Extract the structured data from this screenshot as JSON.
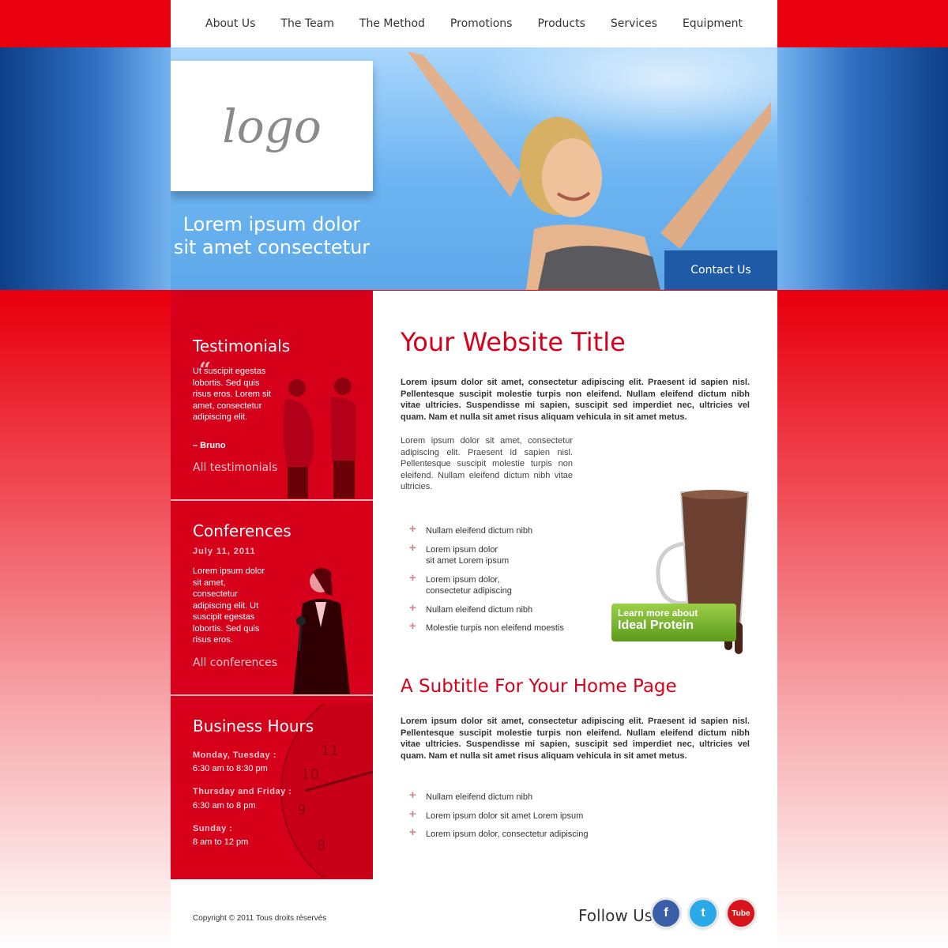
{
  "nav": {
    "items": [
      "About Us",
      "The Team",
      "The Method",
      "Promotions",
      "Products",
      "Services",
      "Equipment"
    ]
  },
  "hero": {
    "logo": "logo",
    "tagline_line1": "Lorem ipsum dolor",
    "tagline_line2": "sit amet consectetur",
    "contact_button": "Contact Us"
  },
  "sidebar": {
    "testimonials": {
      "title": "Testimonials",
      "quote": "Ut suscipit egestas lobortis. Sed quis risus eros. Lorem sit amet, consectetur adipiscing elit.",
      "author": "– Bruno",
      "link": "All testimonials"
    },
    "conferences": {
      "title": "Conferences",
      "date": "July 11, 2011",
      "text": "Lorem ipsum dolor sit amet, consectetur adipiscing elit. Ut suscipit egestas lobortis. Sed quis risus eros.",
      "link": "All conferences"
    },
    "hours": {
      "title": "Business Hours",
      "rows": [
        {
          "label": "Monday, Tuesday :",
          "value": "6:30 am to 8:30 pm"
        },
        {
          "label": "Thursday and Friday :",
          "value": "6:30 am to 8 pm"
        },
        {
          "label": "Sunday :",
          "value": "8 am to 12 pm"
        }
      ]
    }
  },
  "main": {
    "title": "Your Website Title",
    "intro": "Lorem ipsum dolor sit amet, consectetur adipiscing elit. Praesent id sapien nisl. Pellentesque suscipit molestie turpis non eleifend. Nullam eleifend dictum nibh vitae ultricies. Suspendisse mi sapien, suscipit sed imperdiet nec, ultricies vel quam. Nam et nulla sit amet risus aliquam vehicula in sit amet metus.",
    "para": "Lorem ipsum dolor sit amet, consectetur adipiscing elit. Praesent id sapien nisl. Pellentesque suscipit molestie turpis non eleifend. Nullam eleifend dictum nibh vitae ultricies.",
    "bullets1": [
      "Nullam eleifend dictum nibh",
      "Lorem ipsum dolor\nsit amet Lorem ipsum",
      "Lorem ipsum dolor,\nconsectetur adipiscing",
      "Nullam eleifend dictum nibh",
      "Molestie turpis non eleifend moestis"
    ],
    "promo_line1": "Learn more about",
    "promo_line2": "Ideal Protein",
    "subtitle": "A Subtitle For Your Home Page",
    "intro2": "Lorem ipsum dolor sit amet, consectetur adipiscing elit. Praesent id sapien nisl. Pellentesque suscipit molestie turpis non eleifend. Nullam eleifend dictum nibh vitae ultricies. Suspendisse mi sapien, suscipit sed imperdiet nec, ultricies vel quam. Nam et nulla sit amet risus aliquam vehicula in sit amet metus.",
    "bullets2": [
      "Nullam eleifend dictum nibh",
      "Lorem ipsum dolor sit amet Lorem ipsum",
      "Lorem ipsum dolor, consectetur adipiscing"
    ]
  },
  "footer": {
    "copyright": "Copyright © 2011 Tous droits réservés",
    "follow": "Follow Us",
    "social": [
      {
        "name": "facebook-icon",
        "glyph": "f",
        "color": "#3b5ea8"
      },
      {
        "name": "twitter-icon",
        "glyph": "t",
        "color": "#2aa9e8"
      },
      {
        "name": "youtube-icon",
        "glyph": "Tube",
        "color": "#d7141c"
      }
    ]
  },
  "colors": {
    "accent_red": "#d7001a",
    "hero_blue": "#1e5aa5"
  }
}
